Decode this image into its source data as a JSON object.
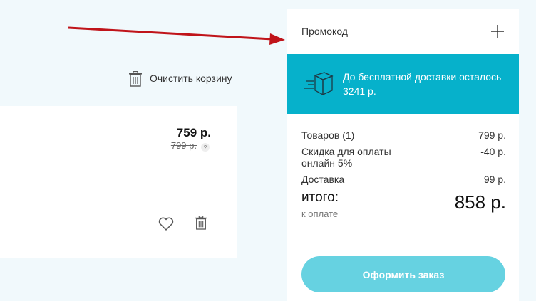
{
  "cart": {
    "clear_label": "Очистить корзину"
  },
  "item": {
    "price": "759 р.",
    "old_price": "799 р.",
    "help_mark": "?"
  },
  "summary": {
    "promo_label": "Промокод",
    "delivery_text_line1": "До бесплатной доставки осталось",
    "delivery_text_line2": "3241 р.",
    "rows": [
      {
        "label": "Товаров (1)",
        "value": "799 р."
      },
      {
        "label": "Скидка для оплаты онлайн 5%",
        "value": "-40 р."
      },
      {
        "label": "Доставка",
        "value": "99 р."
      }
    ],
    "total_title": "итого:",
    "total_sub": "к оплате",
    "total_amount": "858 р.",
    "checkout_label": "Оформить заказ"
  },
  "colors": {
    "accent": "#06b1cb",
    "button": "#66d2e1",
    "annotation_arrow": "#c0141a"
  },
  "icons": [
    "trash-icon",
    "heart-icon",
    "box-icon",
    "plus-icon",
    "help-icon",
    "annotation-arrow"
  ]
}
